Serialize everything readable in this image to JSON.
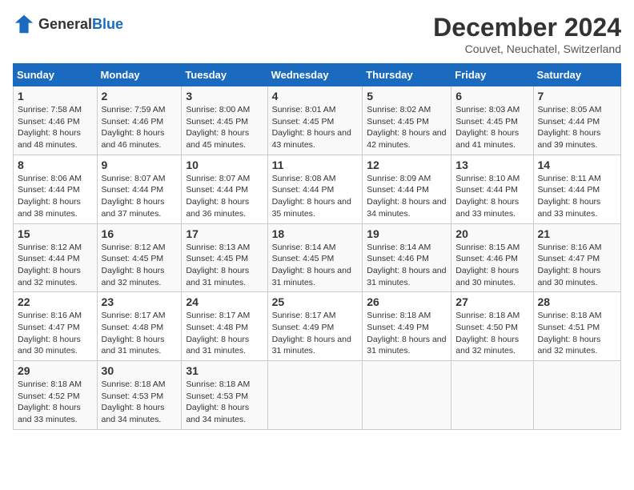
{
  "logo": {
    "general": "General",
    "blue": "Blue"
  },
  "title": "December 2024",
  "subtitle": "Couvet, Neuchatel, Switzerland",
  "headers": [
    "Sunday",
    "Monday",
    "Tuesday",
    "Wednesday",
    "Thursday",
    "Friday",
    "Saturday"
  ],
  "weeks": [
    [
      {
        "day": "1",
        "sunrise": "7:58 AM",
        "sunset": "4:46 PM",
        "daylight": "8 hours and 48 minutes."
      },
      {
        "day": "2",
        "sunrise": "7:59 AM",
        "sunset": "4:46 PM",
        "daylight": "8 hours and 46 minutes."
      },
      {
        "day": "3",
        "sunrise": "8:00 AM",
        "sunset": "4:45 PM",
        "daylight": "8 hours and 45 minutes."
      },
      {
        "day": "4",
        "sunrise": "8:01 AM",
        "sunset": "4:45 PM",
        "daylight": "8 hours and 43 minutes."
      },
      {
        "day": "5",
        "sunrise": "8:02 AM",
        "sunset": "4:45 PM",
        "daylight": "8 hours and 42 minutes."
      },
      {
        "day": "6",
        "sunrise": "8:03 AM",
        "sunset": "4:45 PM",
        "daylight": "8 hours and 41 minutes."
      },
      {
        "day": "7",
        "sunrise": "8:05 AM",
        "sunset": "4:44 PM",
        "daylight": "8 hours and 39 minutes."
      }
    ],
    [
      {
        "day": "8",
        "sunrise": "8:06 AM",
        "sunset": "4:44 PM",
        "daylight": "8 hours and 38 minutes."
      },
      {
        "day": "9",
        "sunrise": "8:07 AM",
        "sunset": "4:44 PM",
        "daylight": "8 hours and 37 minutes."
      },
      {
        "day": "10",
        "sunrise": "8:07 AM",
        "sunset": "4:44 PM",
        "daylight": "8 hours and 36 minutes."
      },
      {
        "day": "11",
        "sunrise": "8:08 AM",
        "sunset": "4:44 PM",
        "daylight": "8 hours and 35 minutes."
      },
      {
        "day": "12",
        "sunrise": "8:09 AM",
        "sunset": "4:44 PM",
        "daylight": "8 hours and 34 minutes."
      },
      {
        "day": "13",
        "sunrise": "8:10 AM",
        "sunset": "4:44 PM",
        "daylight": "8 hours and 33 minutes."
      },
      {
        "day": "14",
        "sunrise": "8:11 AM",
        "sunset": "4:44 PM",
        "daylight": "8 hours and 33 minutes."
      }
    ],
    [
      {
        "day": "15",
        "sunrise": "8:12 AM",
        "sunset": "4:44 PM",
        "daylight": "8 hours and 32 minutes."
      },
      {
        "day": "16",
        "sunrise": "8:12 AM",
        "sunset": "4:45 PM",
        "daylight": "8 hours and 32 minutes."
      },
      {
        "day": "17",
        "sunrise": "8:13 AM",
        "sunset": "4:45 PM",
        "daylight": "8 hours and 31 minutes."
      },
      {
        "day": "18",
        "sunrise": "8:14 AM",
        "sunset": "4:45 PM",
        "daylight": "8 hours and 31 minutes."
      },
      {
        "day": "19",
        "sunrise": "8:14 AM",
        "sunset": "4:46 PM",
        "daylight": "8 hours and 31 minutes."
      },
      {
        "day": "20",
        "sunrise": "8:15 AM",
        "sunset": "4:46 PM",
        "daylight": "8 hours and 30 minutes."
      },
      {
        "day": "21",
        "sunrise": "8:16 AM",
        "sunset": "4:47 PM",
        "daylight": "8 hours and 30 minutes."
      }
    ],
    [
      {
        "day": "22",
        "sunrise": "8:16 AM",
        "sunset": "4:47 PM",
        "daylight": "8 hours and 30 minutes."
      },
      {
        "day": "23",
        "sunrise": "8:17 AM",
        "sunset": "4:48 PM",
        "daylight": "8 hours and 31 minutes."
      },
      {
        "day": "24",
        "sunrise": "8:17 AM",
        "sunset": "4:48 PM",
        "daylight": "8 hours and 31 minutes."
      },
      {
        "day": "25",
        "sunrise": "8:17 AM",
        "sunset": "4:49 PM",
        "daylight": "8 hours and 31 minutes."
      },
      {
        "day": "26",
        "sunrise": "8:18 AM",
        "sunset": "4:49 PM",
        "daylight": "8 hours and 31 minutes."
      },
      {
        "day": "27",
        "sunrise": "8:18 AM",
        "sunset": "4:50 PM",
        "daylight": "8 hours and 32 minutes."
      },
      {
        "day": "28",
        "sunrise": "8:18 AM",
        "sunset": "4:51 PM",
        "daylight": "8 hours and 32 minutes."
      }
    ],
    [
      {
        "day": "29",
        "sunrise": "8:18 AM",
        "sunset": "4:52 PM",
        "daylight": "8 hours and 33 minutes."
      },
      {
        "day": "30",
        "sunrise": "8:18 AM",
        "sunset": "4:53 PM",
        "daylight": "8 hours and 34 minutes."
      },
      {
        "day": "31",
        "sunrise": "8:18 AM",
        "sunset": "4:53 PM",
        "daylight": "8 hours and 34 minutes."
      },
      null,
      null,
      null,
      null
    ]
  ]
}
